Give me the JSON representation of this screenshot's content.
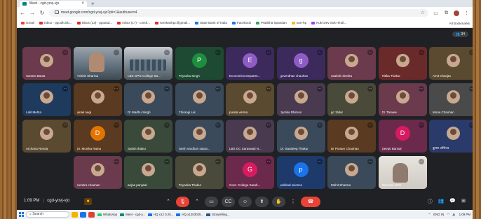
{
  "browser": {
    "tab_title": "Meet - cgd-yovj-vjo",
    "new_tab_symbol": "+",
    "url": "meet.google.com/cgd-yovj-vjo?pli=1&authuser=4",
    "bookmarks": [
      {
        "label": "Gmail",
        "color": "#ea4335"
      },
      {
        "label": "Inbox - pgcollcinb...",
        "color": "#d93025"
      },
      {
        "label": "Inbox (13) - pgoasd...",
        "color": "#d93025"
      },
      {
        "label": "Inbox (17) - corsh...",
        "color": "#d93025"
      },
      {
        "label": "semkanhpc@gmail...",
        "color": "#d93025"
      },
      {
        "label": "State Bank of India",
        "color": "#1a73e8"
      },
      {
        "label": "Facebook",
        "color": "#1877f2"
      },
      {
        "label": "Pratibha Spandan",
        "color": "#34a853"
      },
      {
        "label": "uoe-hp",
        "color": "#fbbc04"
      },
      {
        "label": "Kuki Dev Sok Hindi...",
        "color": "#a142f4"
      }
    ],
    "all_bookmarks": "All Bookmarks"
  },
  "meet": {
    "participant_count": "34",
    "time": "1:09 PM",
    "meeting_code": "cgd-yovj-vjo",
    "participants": [
      {
        "name": "Sanam Banta",
        "kind": "photo",
        "bg": "#6b3a4c"
      },
      {
        "name": "Ashish Sharma",
        "kind": "video",
        "bg": "#e7e4df"
      },
      {
        "name": "LBS GPG College Sa...",
        "kind": "room",
        "bg": "#6e7e8c"
      },
      {
        "name": "Priyanka Singh",
        "kind": "letter",
        "letter": "P",
        "bg": "#1e4a34",
        "circle": "#1e8e3e"
      },
      {
        "name": "Economics Departm...",
        "kind": "letter",
        "letter": "E",
        "bg": "#3c2a5c",
        "circle": "#8e5cc4"
      },
      {
        "name": "goverdhan chauhan",
        "kind": "letter",
        "letter": "g",
        "bg": "#3c2a5c",
        "circle": "#8e5cc4"
      },
      {
        "name": "saakshi deshta",
        "kind": "photo",
        "bg": "#6b3a4c"
      },
      {
        "name": "Ritika Thakur",
        "kind": "photo",
        "bg": "#6b2a2a"
      },
      {
        "name": "Amit Chanjta",
        "kind": "photo",
        "bg": "#5a4a30"
      },
      {
        "name": "Lalit Mehta",
        "kind": "photo",
        "bg": "#1e3a5c"
      },
      {
        "name": "janak negi",
        "kind": "photo",
        "bg": "#5a3a20"
      },
      {
        "name": "Dr Madhu Singh",
        "kind": "photo",
        "bg": "#3a4a5a"
      },
      {
        "name": "Chirangi Lal",
        "kind": "photo",
        "bg": "#3a4a5a"
      },
      {
        "name": "punita verma",
        "kind": "photo",
        "bg": "#5a4a30"
      },
      {
        "name": "Jyotika Dhiman",
        "kind": "photo",
        "bg": "#4a3a50"
      },
      {
        "name": "gc 1bilar",
        "kind": "photo",
        "bg": "#4a4a3a"
      },
      {
        "name": "Dr. Tanvee",
        "kind": "photo",
        "bg": "#6b3a4c"
      },
      {
        "name": "Mona Chauhan",
        "kind": "photo",
        "bg": "#4a4a4a"
      },
      {
        "name": "Archana Renda",
        "kind": "photo",
        "bg": "#5a4a30"
      },
      {
        "name": "Dr. Monika Raina",
        "kind": "letter",
        "letter": "D",
        "bg": "#5a3a20",
        "circle": "#e37400"
      },
      {
        "name": "Satish thakur",
        "kind": "photo",
        "bg": "#3a4a3a"
      },
      {
        "name": "harsh vardhan saara...",
        "kind": "photo",
        "bg": "#3a4a5a"
      },
      {
        "name": "LBS GC Saraswati N...",
        "kind": "photo",
        "bg": "#4a3a50"
      },
      {
        "name": "Dr. Sandeep Thakur",
        "kind": "photo",
        "bg": "#3a4a5a"
      },
      {
        "name": "Dr Punam Chauhan",
        "kind": "photo",
        "bg": "#5a3a20"
      },
      {
        "name": "Deepti Bansal",
        "kind": "letter",
        "letter": "D",
        "bg": "#6b2a4c",
        "circle": "#d81b60"
      },
      {
        "name": "कुमार अभिनव",
        "kind": "photo",
        "bg": "#2a3a6b"
      },
      {
        "name": "sumitra chauhan",
        "kind": "photo",
        "bg": "#6b3a4c"
      },
      {
        "name": "anjna panjwal",
        "kind": "photo",
        "bg": "#3a4a3a"
      },
      {
        "name": "Priyanka Thakur",
        "kind": "photo",
        "bg": "#4a4a3a"
      },
      {
        "name": "Govt. College Sarah...",
        "kind": "letter",
        "letter": "G",
        "bg": "#6b2a4c",
        "circle": "#d81b60"
      },
      {
        "name": "political science",
        "kind": "letter",
        "letter": "p",
        "bg": "#1e3a6b",
        "circle": "#1a73e8"
      },
      {
        "name": "Mohit Sharma",
        "kind": "photo",
        "bg": "#3a4a5a"
      },
      {
        "name": "Seminar HPU",
        "kind": "light",
        "bg": "#e7e4df"
      }
    ]
  },
  "taskbar": {
    "search_placeholder": "Search",
    "apps": [
      {
        "label": "WhatsApp",
        "color": "#25d366"
      },
      {
        "label": "Meet - cgd-y...",
        "color": "#00897b"
      },
      {
        "label": "HQ x12 0.25...",
        "color": "#1a73e8"
      },
      {
        "label": "HQ x1203025...",
        "color": "#1a73e8"
      },
      {
        "label": "Storytelling...",
        "color": "#2b579a"
      }
    ],
    "lang": "ENG IN",
    "clock": "1:09 PM"
  }
}
